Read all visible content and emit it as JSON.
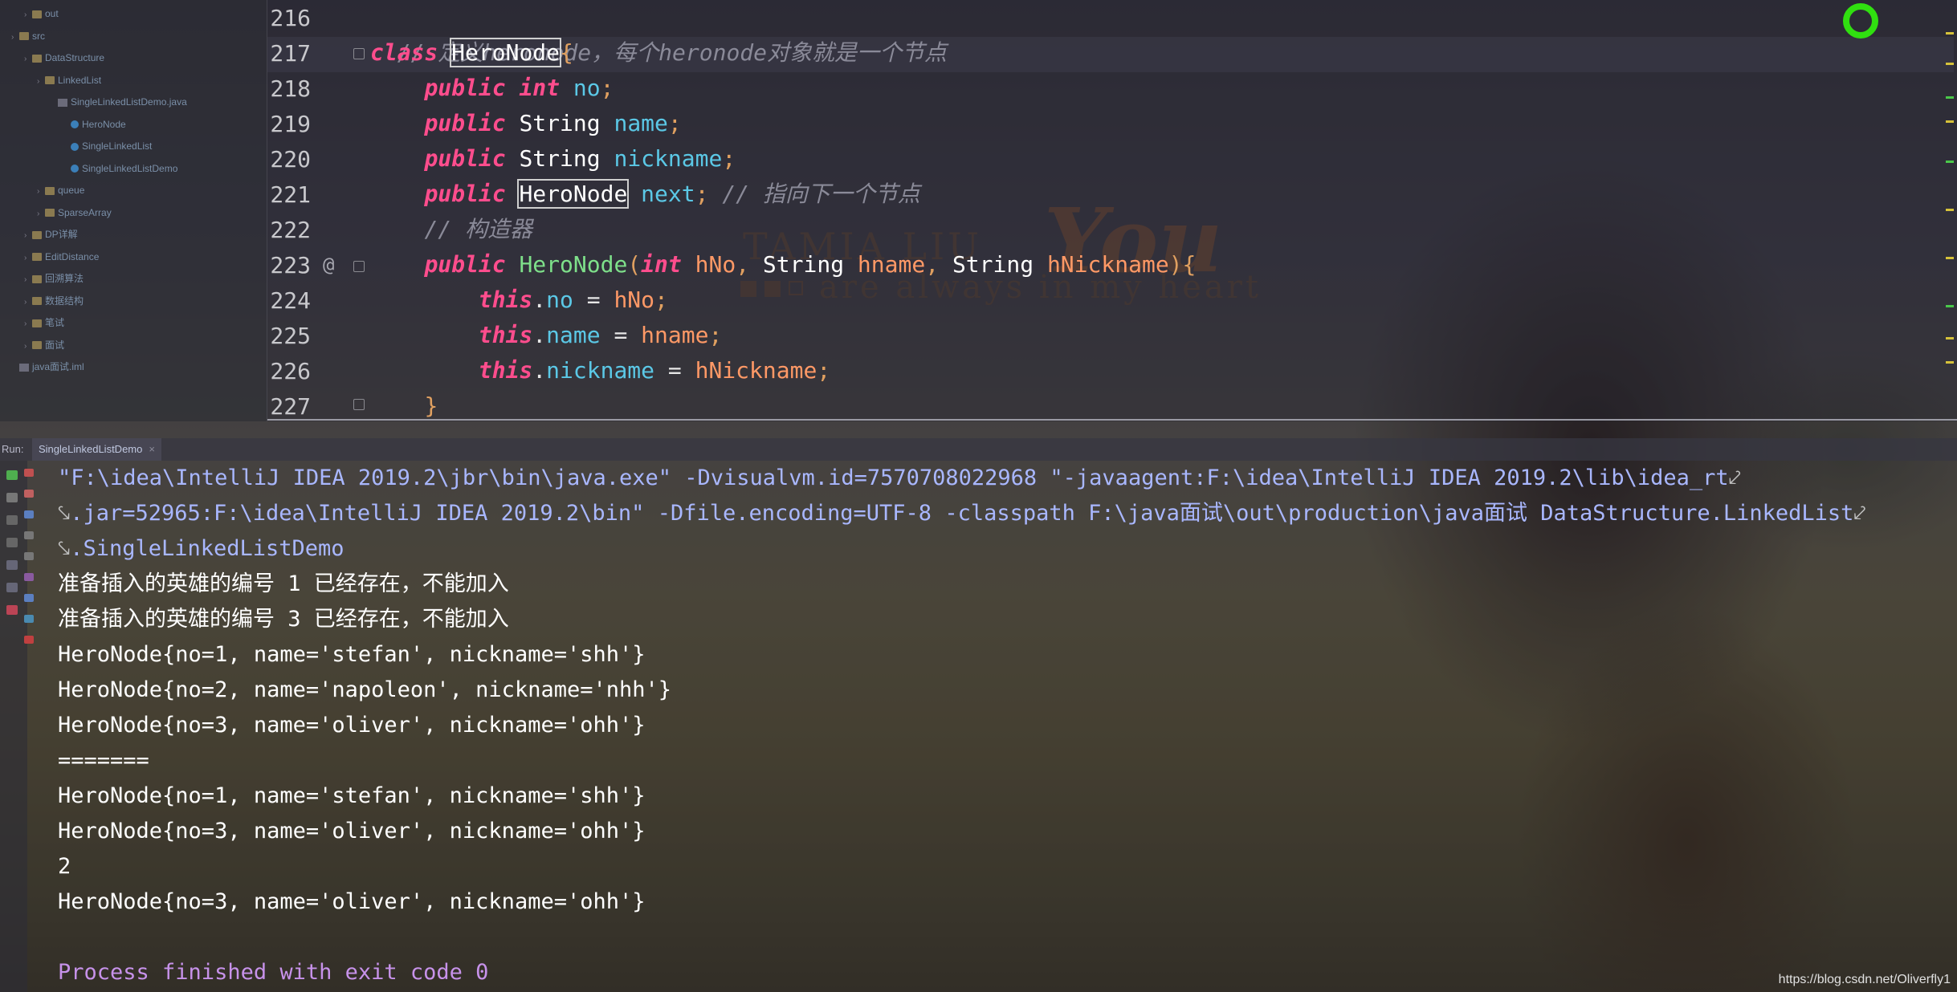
{
  "project_tree": {
    "items": [
      {
        "label": "out",
        "depth": 1,
        "icon": "folder-icon"
      },
      {
        "label": "src",
        "depth": 0,
        "icon": "folder-icon"
      },
      {
        "label": "DataStructure",
        "depth": 1,
        "icon": "folder-icon"
      },
      {
        "label": "LinkedList",
        "depth": 2,
        "icon": "folder-icon"
      },
      {
        "label": "SingleLinkedListDemo.java",
        "depth": 3,
        "icon": "java-file-icon"
      },
      {
        "label": "HeroNode",
        "depth": 4,
        "icon": "class-icon"
      },
      {
        "label": "SingleLinkedList",
        "depth": 4,
        "icon": "class-icon"
      },
      {
        "label": "SingleLinkedListDemo",
        "depth": 4,
        "icon": "class-icon"
      },
      {
        "label": "queue",
        "depth": 2,
        "icon": "folder-icon"
      },
      {
        "label": "SparseArray",
        "depth": 2,
        "icon": "folder-icon"
      },
      {
        "label": "DP详解",
        "depth": 1,
        "icon": "folder-icon"
      },
      {
        "label": "EditDistance",
        "depth": 1,
        "icon": "folder-icon"
      },
      {
        "label": "回溯算法",
        "depth": 1,
        "icon": "folder-icon"
      },
      {
        "label": "数据结构",
        "depth": 1,
        "icon": "folder-icon"
      },
      {
        "label": "笔试",
        "depth": 1,
        "icon": "folder-icon"
      },
      {
        "label": "面试",
        "depth": 1,
        "icon": "folder-icon"
      },
      {
        "label": "java面试.iml",
        "depth": 0,
        "icon": "iml-file-icon"
      }
    ]
  },
  "editor": {
    "lines": [
      {
        "n": "216"
      },
      {
        "n": "217"
      },
      {
        "n": "218"
      },
      {
        "n": "219"
      },
      {
        "n": "220"
      },
      {
        "n": "221"
      },
      {
        "n": "222"
      },
      {
        "n": "223"
      },
      {
        "n": "224"
      },
      {
        "n": "225"
      },
      {
        "n": "226"
      },
      {
        "n": "227"
      }
    ],
    "code": {
      "l216_comment": "// 定义heronode，每个heronode对象就是一个节点",
      "kw_class": "class",
      "kw_public": "public",
      "kw_int": "int",
      "kw_this": "this",
      "type_string": "String",
      "class_name": "HeroNode",
      "field_no": "no",
      "field_name": "name",
      "field_nickname": "nickname",
      "field_next": "next",
      "l221_comment": "// 指向下一个节点",
      "l222_comment": "// 构造器",
      "param_hNo": "hNo",
      "param_hname": "hname",
      "param_hNickname": "hNickname",
      "brace_open": "{",
      "brace_close": "}",
      "semi": ";",
      "comma": ",",
      "paren_open": "(",
      "paren_close": ")",
      "dot": ".",
      "eq": " = ",
      "at_marker": "@"
    },
    "watermark": {
      "line1": "TAMIA LIU",
      "line2": "You",
      "line3": "are always in my heart"
    },
    "accent_colors": {
      "keyword": "#ff4d8d",
      "field": "#5bc8e6",
      "inspection": "#30e010"
    }
  },
  "run_panel": {
    "label": "Run:",
    "tab": "SingleLinkedListDemo",
    "tab_close": "×",
    "output": [
      {
        "text": "\"F:\\idea\\IntelliJ IDEA 2019.2\\jbr\\bin\\java.exe\" -Dvisualvm.id=7570708022968 \"-javaagent:F:\\idea\\IntelliJ IDEA 2019.2\\lib\\idea_rt",
        "kind": "cmd"
      },
      {
        "text": ".jar=52965:F:\\idea\\IntelliJ IDEA 2019.2\\bin\" -Dfile.encoding=UTF-8 -classpath F:\\java面试\\out\\production\\java面试 DataStructure.LinkedList",
        "kind": "cmd"
      },
      {
        "text": ".SingleLinkedListDemo",
        "kind": "cmd"
      },
      {
        "text": "准备插入的英雄的编号 1 已经存在，不能加入",
        "kind": "out"
      },
      {
        "text": "准备插入的英雄的编号 3 已经存在，不能加入",
        "kind": "out"
      },
      {
        "text": "HeroNode{no=1, name='stefan', nickname='shh'}",
        "kind": "out"
      },
      {
        "text": "HeroNode{no=2, name='napoleon', nickname='nhh'}",
        "kind": "out"
      },
      {
        "text": "HeroNode{no=3, name='oliver', nickname='ohh'}",
        "kind": "out"
      },
      {
        "text": "=======",
        "kind": "out"
      },
      {
        "text": "HeroNode{no=1, name='stefan', nickname='shh'}",
        "kind": "out"
      },
      {
        "text": "HeroNode{no=3, name='oliver', nickname='ohh'}",
        "kind": "out"
      },
      {
        "text": "2",
        "kind": "out"
      },
      {
        "text": "HeroNode{no=3, name='oliver', nickname='ohh'}",
        "kind": "out"
      },
      {
        "text": "",
        "kind": "out"
      },
      {
        "text": "Process finished with exit code 0",
        "kind": "proc"
      }
    ],
    "wrap_glyph": "⤦",
    "wrap_start_glyph": "⤥"
  },
  "credit": "https://blog.csdn.net/Oliverfly1"
}
